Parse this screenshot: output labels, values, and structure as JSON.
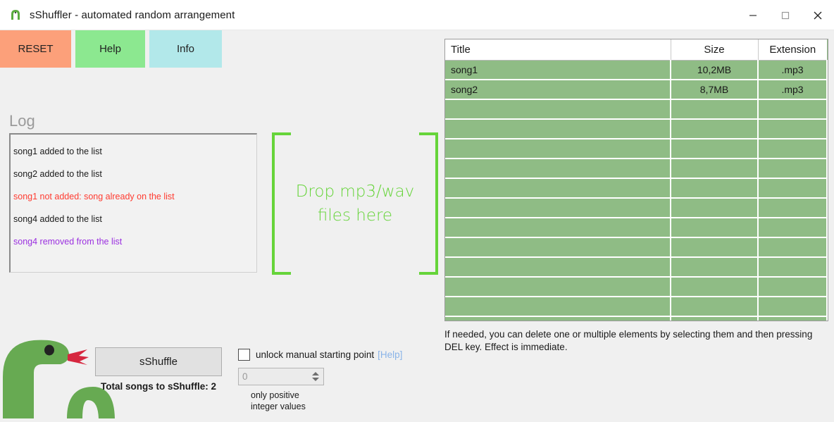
{
  "window": {
    "title": "sShuffler - automated random arrangement",
    "icon": "snake-icon",
    "controls": {
      "minimize": "minimize-icon",
      "maximize": "maximize-icon",
      "close": "close-icon"
    }
  },
  "toolbar": {
    "reset_label": "RESET",
    "help_label": "Help",
    "info_label": "Info",
    "reset_color": "#fca07a",
    "help_color": "#8ce890",
    "info_color": "#b2e8ea"
  },
  "log": {
    "heading": "Log",
    "entries": [
      {
        "text": "song1 added to the list",
        "color": "#1a1a1a"
      },
      {
        "text": "song2 added to the list",
        "color": "#1a1a1a"
      },
      {
        "text": "song1 not added: song already on the list",
        "color": "#ff3b30"
      },
      {
        "text": "song4 added to the list",
        "color": "#1a1a1a"
      },
      {
        "text": "song4 removed from the list",
        "color": "#9b30e0"
      }
    ]
  },
  "dropzone": {
    "line1": "Drop mp3/wav",
    "line2": "files here",
    "color": "#66d43a"
  },
  "filetable": {
    "columns": [
      "Title",
      "Size",
      "Extension"
    ],
    "rows": [
      {
        "title": "song1",
        "size": "10,2MB",
        "extension": ".mp3",
        "focused": false
      },
      {
        "title": "song2",
        "size": "8,7MB",
        "extension": ".mp3",
        "focused": true
      }
    ],
    "empty_row_count": 12,
    "row_color": "#8fbc85",
    "hint": "If needed, you can delete one or multiple elements by selecting them and then pressing DEL key. Effect is immediate."
  },
  "bottom": {
    "shuffle_label": "sShuffle",
    "total_label": "Total songs to sShuffle: 2",
    "checkbox_label": "unlock manual starting point",
    "checkbox_help": "[Help]",
    "checkbox_checked": false,
    "spinner_value": "0",
    "spinner_note_line1": "only positive",
    "spinner_note_line2": "integer values"
  }
}
